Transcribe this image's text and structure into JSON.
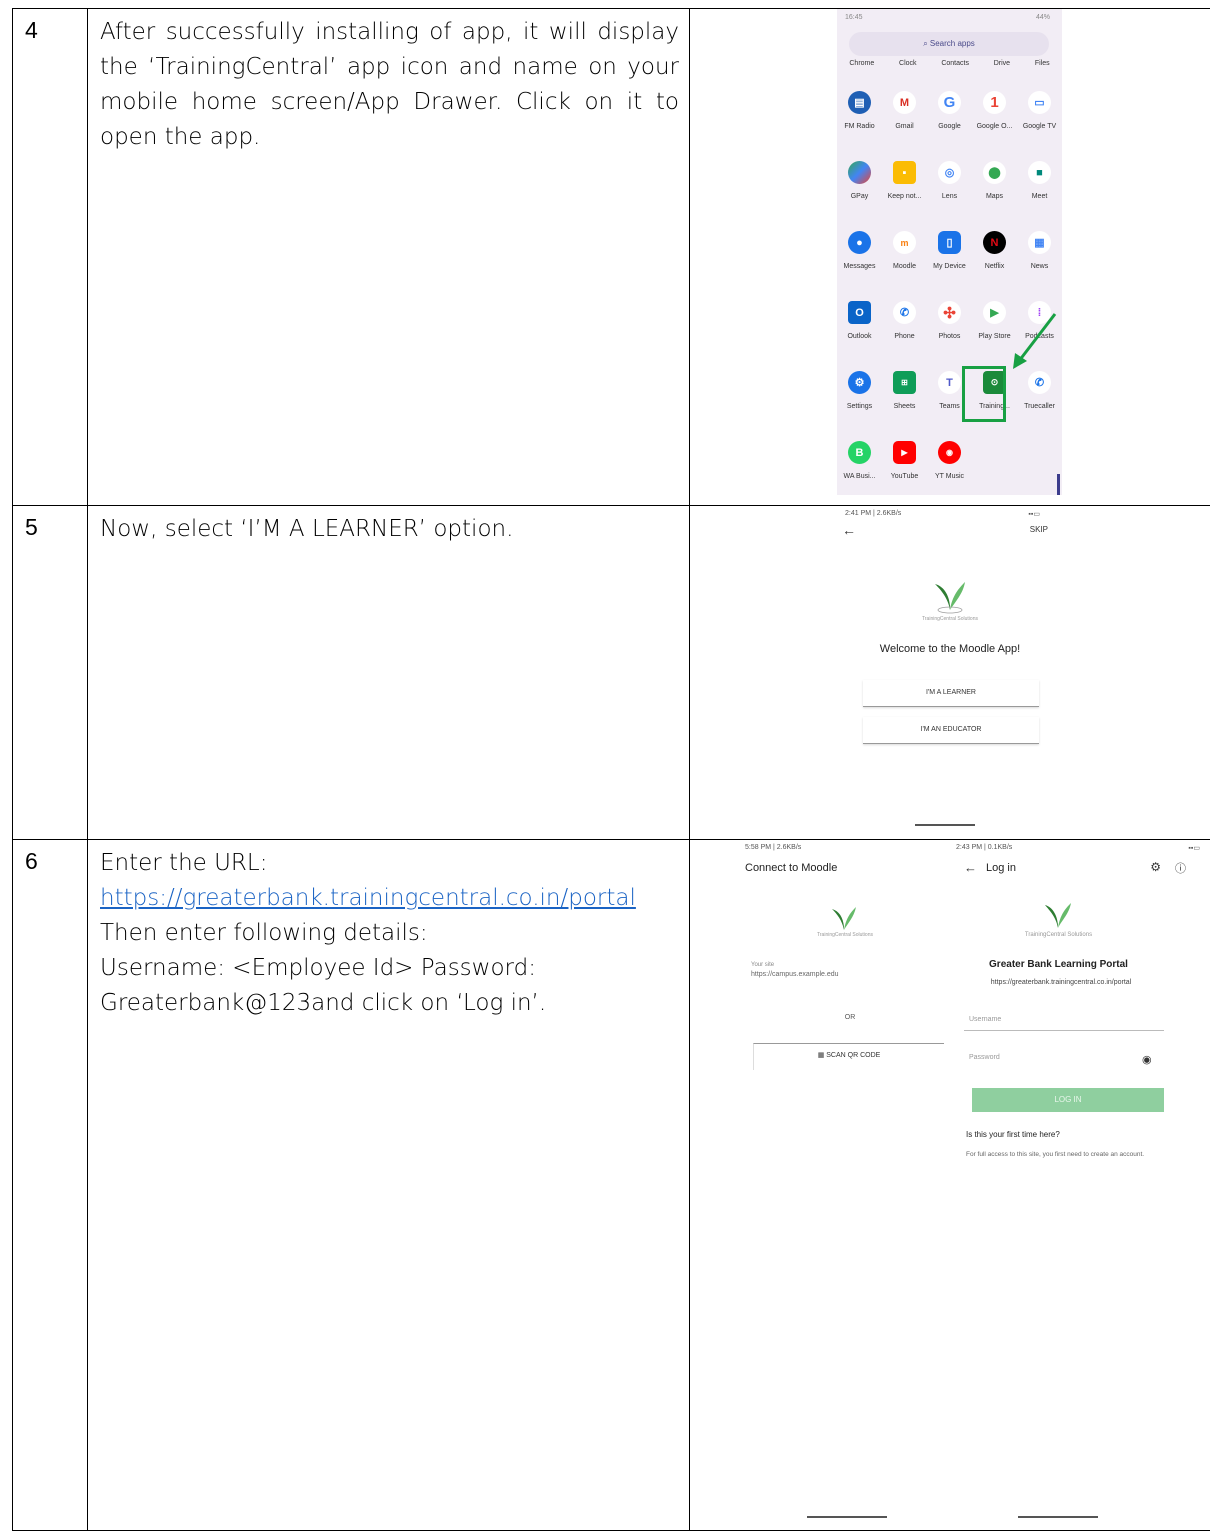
{
  "rows": [
    {
      "num": "4",
      "text": "After successfully installing of app, it will display the ‘TrainingCentral’ app icon and name on your mobile home screen/App Drawer. Click on it to open the app.",
      "screen": {
        "time": "16:45",
        "status": "44%",
        "search": "Search apps",
        "top_apps": [
          "Chrome",
          "Clock",
          "Contacts",
          "Drive",
          "Files"
        ],
        "apps": [
          [
            "FM Radio",
            "Gmail",
            "Google",
            "Google O...",
            "Google TV"
          ],
          [
            "GPay",
            "Keep not...",
            "Lens",
            "Maps",
            "Meet"
          ],
          [
            "Messages",
            "Moodle",
            "My Device",
            "Netflix",
            "News"
          ],
          [
            "Outlook",
            "Phone",
            "Photos",
            "Play Store",
            "Podcasts"
          ],
          [
            "Settings",
            "Sheets",
            "Teams",
            "Training...",
            "Truecaller"
          ],
          [
            "WA Busi...",
            "YouTube",
            "YT Music",
            "",
            ""
          ]
        ]
      }
    },
    {
      "num": "5",
      "text": "Now, select ‘I’M A LEARNER’ option.",
      "screen": {
        "status": "2:41 PM | 2.6KB/s",
        "skip": "SKIP",
        "logo_caption": "TrainingCentral Solutions",
        "welcome": "Welcome to the Moodle App!",
        "btn_learner": "I'M A LEARNER",
        "btn_educator": "I'M AN EDUCATOR"
      }
    },
    {
      "num": "6",
      "text_intro": "Enter the URL:",
      "url": "https://greaterbank.trainingcentral.co.in/portal",
      "text_rest1": "Then enter following details:",
      "text_rest2": "Username: <Employee Id> Password:",
      "text_rest3": "Greaterbank@123and click on ‘Log in’.",
      "connect": {
        "status": "5:58 PM | 2.6KB/s",
        "title": "Connect to Moodle",
        "logo_caption": "TrainingCentral Solutions",
        "site_label": "Your site",
        "site_value": "https://campus.example.edu",
        "or": "OR",
        "scan": "SCAN QR CODE"
      },
      "login": {
        "status": "2:43 PM | 0.1KB/s",
        "title": "Log in",
        "logo_caption": "TrainingCentral Solutions",
        "portal": "Greater Bank Learning Portal",
        "portal_url": "https://greaterbank.trainingcentral.co.in/portal",
        "username": "Username",
        "password": "Password",
        "login_btn": "LOG IN",
        "first_time": "Is this your first time here?",
        "info": "For full access to this site, you first need to create an account."
      }
    }
  ],
  "colors": {
    "highlight": "#18a043",
    "link": "#1a63c4",
    "login_button": "#8fcf9f"
  }
}
